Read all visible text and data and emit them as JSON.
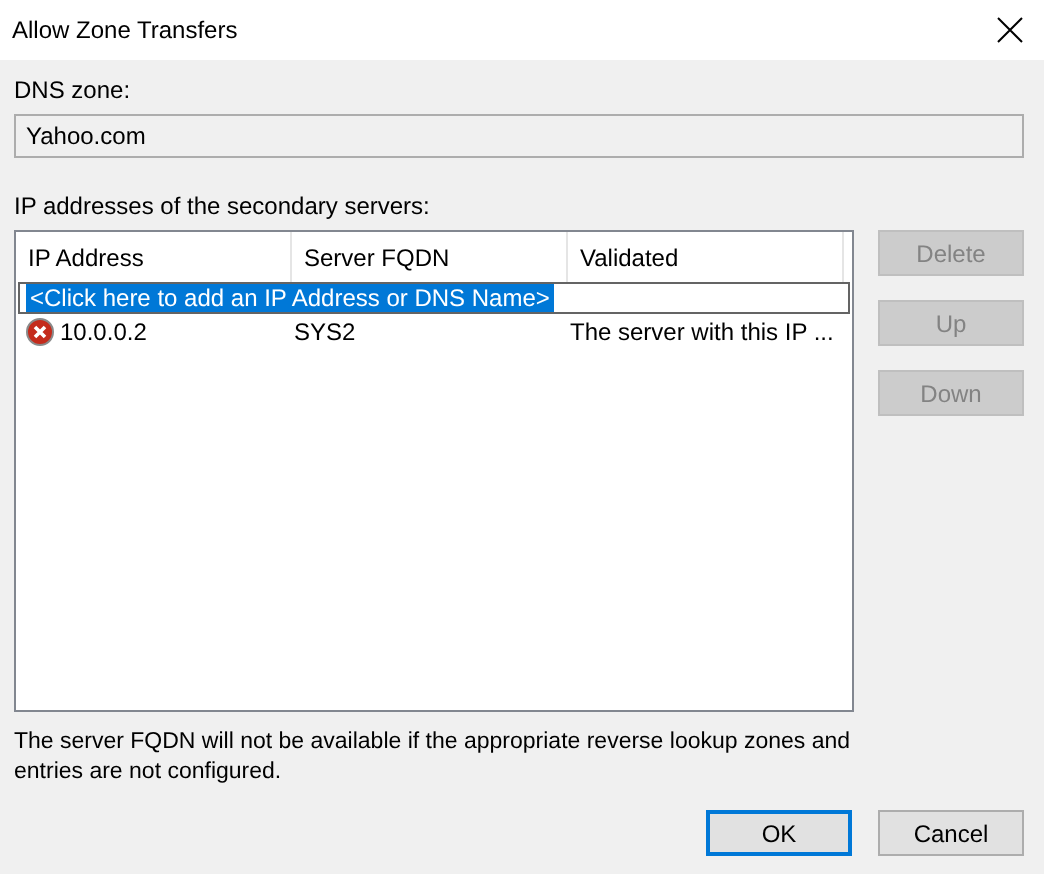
{
  "window": {
    "title": "Allow Zone Transfers"
  },
  "dns_zone": {
    "label": "DNS zone:",
    "value": "Yahoo.com"
  },
  "servers": {
    "label": "IP addresses of the secondary servers:",
    "columns": [
      "IP Address",
      "Server FQDN",
      "Validated"
    ],
    "add_row": {
      "text": "<Click here to add an IP Address or DNS Name>",
      "selected": true
    },
    "rows": [
      {
        "error": true,
        "ip": "10.0.0.2",
        "fqdn": "SYS2",
        "validated": "The server with this IP ..."
      }
    ]
  },
  "side_buttons": [
    {
      "label": "Delete",
      "disabled": true
    },
    {
      "label": "Up",
      "disabled": true
    },
    {
      "label": "Down",
      "disabled": true
    }
  ],
  "note": "The server FQDN will not be available if the appropriate reverse lookup zones and entries are not configured.",
  "buttons": [
    {
      "label": "OK",
      "default": true
    },
    {
      "label": "Cancel",
      "default": false
    }
  ]
}
